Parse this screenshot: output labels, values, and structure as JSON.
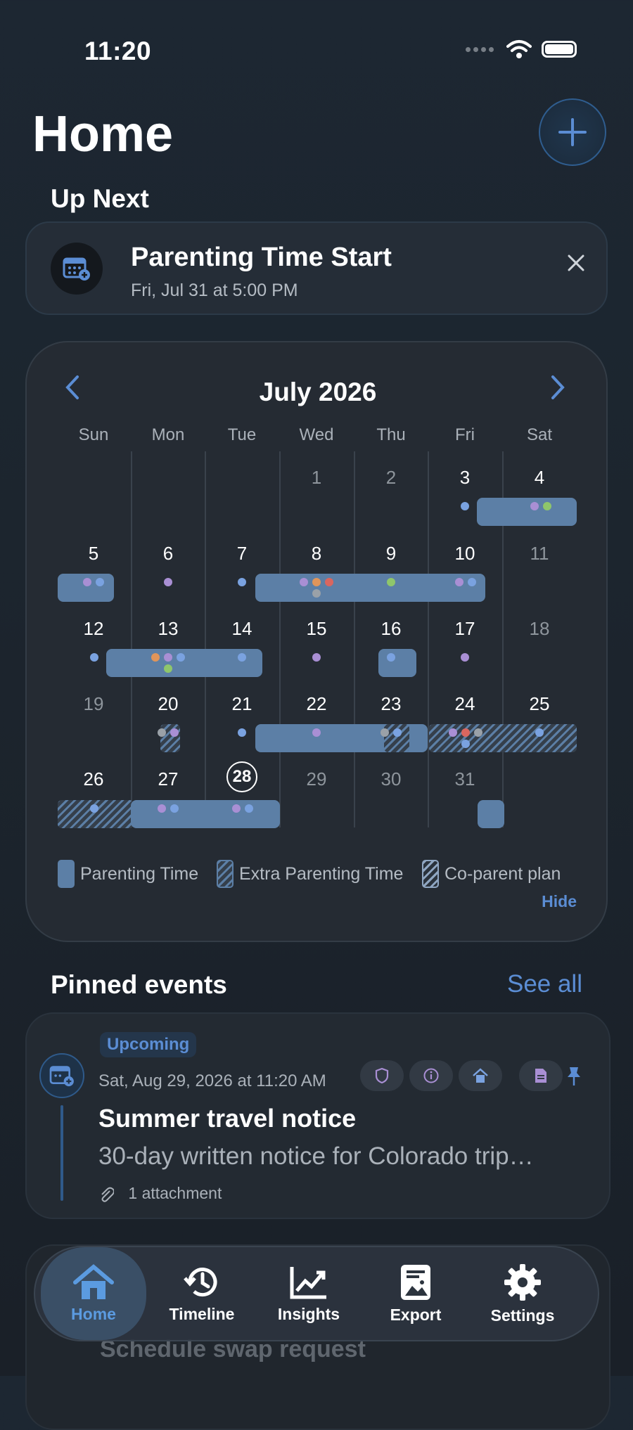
{
  "status_bar": {
    "time": "11:20"
  },
  "header": {
    "title": "Home"
  },
  "up_next": {
    "section_title": "Up Next",
    "title": "Parenting Time Start",
    "subtitle": "Fri, Jul 31 at 5:00 PM"
  },
  "calendar": {
    "month": "July 2026",
    "weekdays": [
      "Sun",
      "Mon",
      "Tue",
      "Wed",
      "Thu",
      "Fri",
      "Sat"
    ],
    "weeks": [
      [
        "",
        "",
        "",
        "1",
        "2",
        "3",
        "4"
      ],
      [
        "5",
        "6",
        "7",
        "8",
        "9",
        "10",
        "11"
      ],
      [
        "12",
        "13",
        "14",
        "15",
        "16",
        "17",
        "18"
      ],
      [
        "19",
        "20",
        "21",
        "22",
        "23",
        "24",
        "25"
      ],
      [
        "26",
        "27",
        "28",
        "29",
        "30",
        "31",
        ""
      ]
    ],
    "today": "28",
    "legend": {
      "parenting": "Parenting Time",
      "extra": "Extra Parenting Time",
      "coparent": "Co-parent plan"
    },
    "hide_label": "Hide"
  },
  "pinned": {
    "section_title": "Pinned events",
    "see_all": "See all",
    "event": {
      "badge": "Upcoming",
      "date": "Sat, Aug 29, 2026 at 11:20 AM",
      "title": "Summer travel notice",
      "description": "30-day written notice for Colorado trip…",
      "attachments": "1 attachment"
    },
    "next_event_title": "Schedule swap request"
  },
  "tabbar": {
    "tabs": [
      {
        "label": "Home",
        "icon": "house-icon",
        "active": true
      },
      {
        "label": "Timeline",
        "icon": "clock-history-icon",
        "active": false
      },
      {
        "label": "Insights",
        "icon": "chart-line-icon",
        "active": false
      },
      {
        "label": "Export",
        "icon": "document-image-icon",
        "active": false
      },
      {
        "label": "Settings",
        "icon": "gear-icon",
        "active": false
      }
    ]
  },
  "colors": {
    "accent": "#5b8dd4",
    "band": "#5c7fa6",
    "dot_blue": "#7aa2e0",
    "dot_purple": "#a98fd4",
    "dot_orange": "#e0955a",
    "dot_green": "#8fc66b",
    "dot_red": "#d9665f",
    "dot_gray": "#9aa1a8"
  }
}
